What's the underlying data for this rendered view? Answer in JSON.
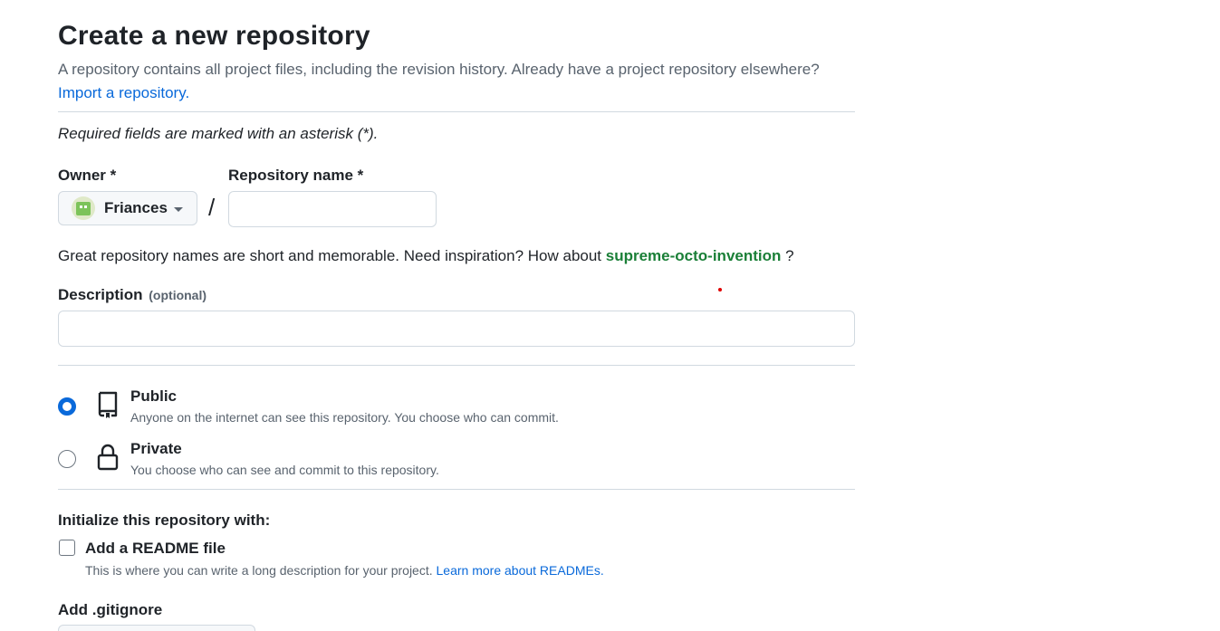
{
  "page": {
    "title": "Create a new repository",
    "subtitle": "A repository contains all project files, including the revision history. Already have a project repository elsewhere?",
    "import_link": "Import a repository.",
    "required_note": "Required fields are marked with an asterisk (*)."
  },
  "owner": {
    "label": "Owner *",
    "value": "Friances",
    "avatar_color": "#7cc35a"
  },
  "repository": {
    "label": "Repository name *",
    "value": "",
    "separator": "/"
  },
  "suggestion": {
    "prefix": "Great repository names are short and memorable. Need inspiration? How about",
    "name": "supreme-octo-invention",
    "suffix": "?"
  },
  "description": {
    "label": "Description",
    "optional_tag": "(optional)",
    "value": ""
  },
  "visibility": {
    "selected": "public",
    "options": [
      {
        "id": "public",
        "title": "Public",
        "description": "Anyone on the internet can see this repository. You choose who can commit.",
        "icon": "repo-icon"
      },
      {
        "id": "private",
        "title": "Private",
        "description": "You choose who can see and commit to this repository.",
        "icon": "lock-icon"
      }
    ]
  },
  "initialize": {
    "title": "Initialize this repository with:",
    "readme": {
      "label": "Add a README file",
      "checked": false,
      "description": "This is where you can write a long description for your project.",
      "link": "Learn more about READMEs."
    },
    "gitignore": {
      "label": "Add .gitignore"
    }
  },
  "colors": {
    "accent": "#0969da",
    "suggestion": "#1a7f37",
    "muted": "#59636e",
    "border": "#d1d9e0"
  }
}
